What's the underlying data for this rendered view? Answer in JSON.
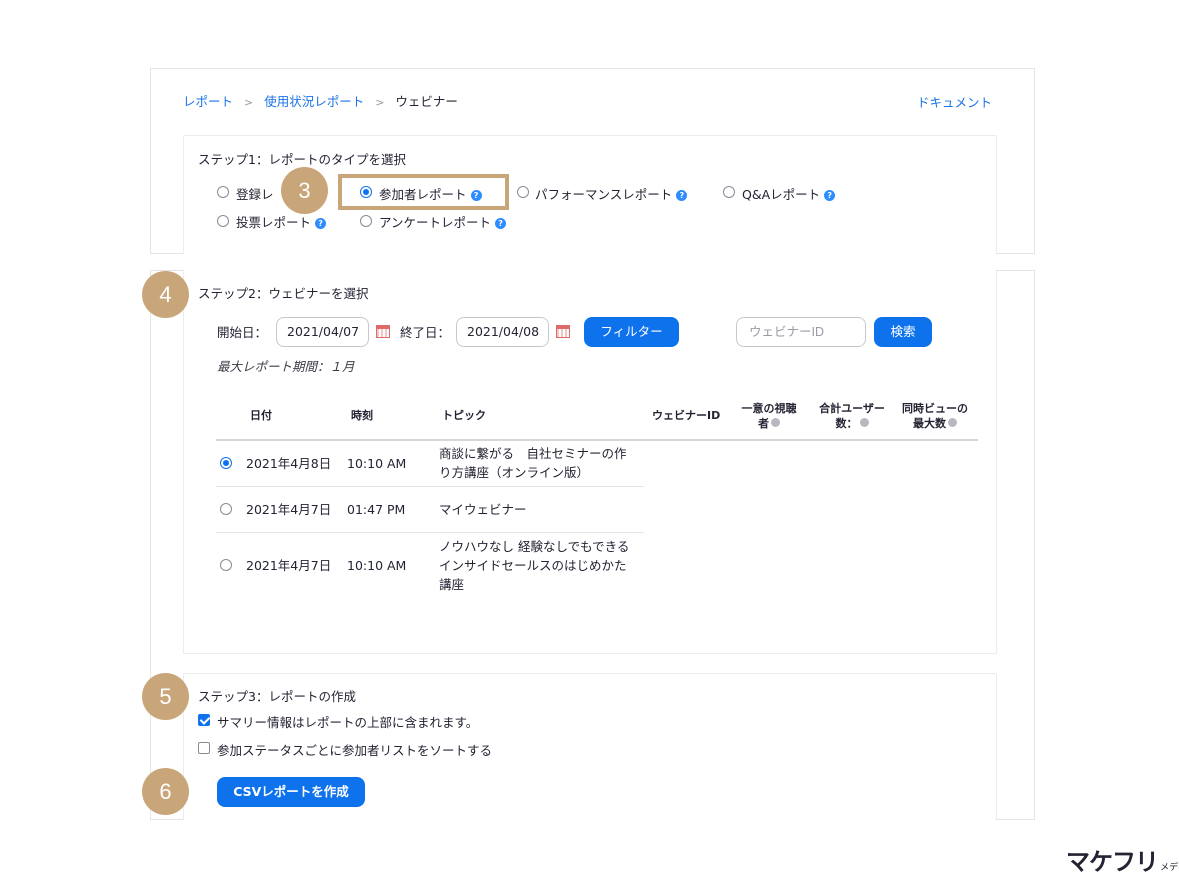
{
  "breadcrumb": {
    "items": [
      "レポート",
      "使用状況レポート",
      "ウェビナー"
    ],
    "separator": ">"
  },
  "doc_link": "ドキュメント",
  "step1": {
    "title": "ステップ1：レポートのタイプを選択",
    "options": [
      {
        "label": "登録レポート",
        "visible_label": "登録レ",
        "selected": false
      },
      {
        "label": "参加者レポート",
        "selected": true
      },
      {
        "label": "パフォーマンスレポート",
        "selected": false
      },
      {
        "label": "Q&Aレポート",
        "selected": false
      },
      {
        "label": "投票レポート",
        "selected": false
      },
      {
        "label": "アンケートレポート",
        "selected": false
      }
    ],
    "help_glyph": "?"
  },
  "step2": {
    "title": "ステップ2：ウェビナーを選択",
    "start_label": "開始日：",
    "start_value": "2021/04/07",
    "end_label": "終了日：",
    "end_value": "2021/04/08",
    "filter_button": "フィルター",
    "webinar_id_placeholder": "ウェビナーID",
    "search_button": "検索",
    "max_period": "最大レポート期間：１月",
    "table": {
      "headers": {
        "date": "日付",
        "time": "時刻",
        "topic": "トピック",
        "webinar_id": "ウェビナーID",
        "unique_viewers_1": "一意の視聴",
        "unique_viewers_2": "者",
        "total_users_1": "合計ユーザー",
        "total_users_2": "数：",
        "max_concurrent_1": "同時ビューの",
        "max_concurrent_2": "最大数"
      },
      "info_glyph": "i",
      "rows": [
        {
          "selected": true,
          "date": "2021年4月8日",
          "time": "10:10 AM",
          "topic_lines": [
            "商談に繋がる　自社セミナーの作",
            "り方講座（オンライン版）"
          ]
        },
        {
          "selected": false,
          "date": "2021年4月7日",
          "time": "01:47 PM",
          "topic_lines": [
            "マイウェビナー"
          ]
        },
        {
          "selected": false,
          "date": "2021年4月7日",
          "time": "10:10 AM",
          "topic_lines": [
            "ノウハウなし 経験なしでもできる",
            "インサイドセールスのはじめかた",
            "講座"
          ]
        }
      ]
    }
  },
  "step3": {
    "title": "ステップ3：レポートの作成",
    "checkbox1": {
      "label": "サマリー情報はレポートの上部に含まれます。",
      "checked": true
    },
    "checkbox2": {
      "label": "参加ステータスごとに参加者リストをソートする",
      "checked": false
    },
    "create_button": "CSVレポートを作成"
  },
  "badges": {
    "b3": "3",
    "b4": "4",
    "b5": "5",
    "b6": "6"
  },
  "logo": {
    "main": "マケフリ",
    "sub": "メディア"
  },
  "colors": {
    "accent": "#0e72ed",
    "badge": "#c9a67a",
    "link": "#1a73e8"
  }
}
